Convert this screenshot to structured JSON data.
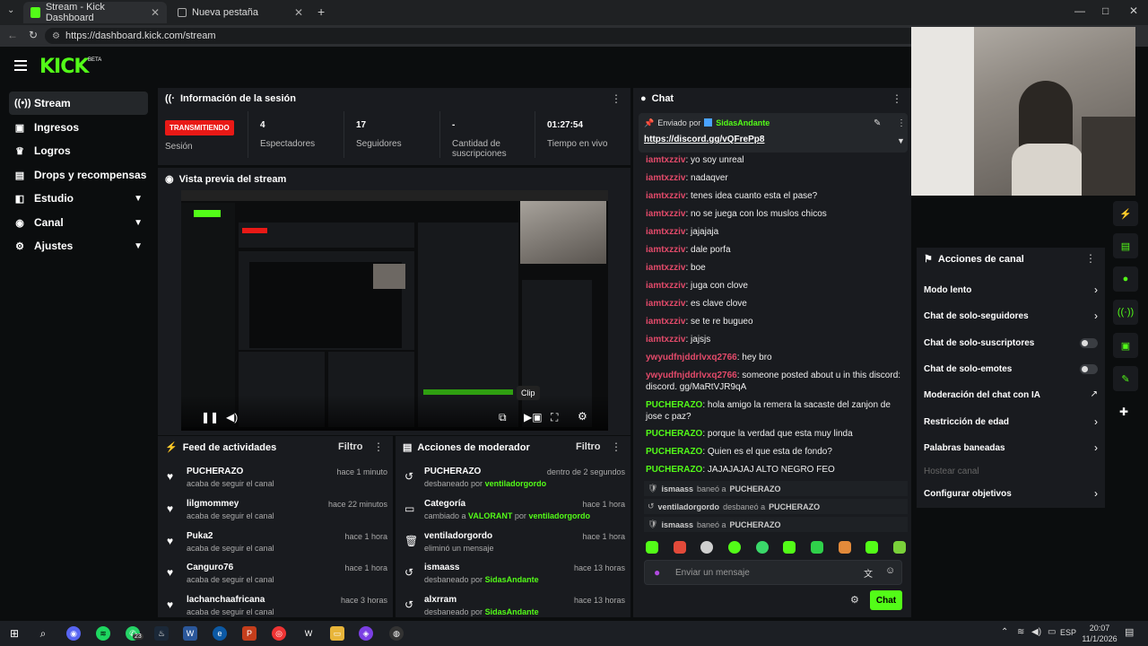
{
  "browser": {
    "tabs": [
      {
        "label": "Stream - Kick Dashboard",
        "active": true
      },
      {
        "label": "Nueva pestaña",
        "active": false
      }
    ],
    "url": "https://dashboard.kick.com/stream"
  },
  "brand": {
    "logo": "KICK",
    "beta": "BETA",
    "accent": "#53fc18"
  },
  "sidebar": {
    "items": [
      {
        "label": "Stream",
        "icon": "broadcast-icon",
        "active": true
      },
      {
        "label": "Ingresos",
        "icon": "dollar-icon"
      },
      {
        "label": "Logros",
        "icon": "trophy-icon"
      },
      {
        "label": "Drops y recompensas",
        "icon": "gift-icon"
      },
      {
        "label": "Estudio",
        "icon": "studio-icon",
        "expandable": true
      },
      {
        "label": "Canal",
        "icon": "channel-icon",
        "expandable": true
      },
      {
        "label": "Ajustes",
        "icon": "gear-icon",
        "expandable": true
      }
    ]
  },
  "session": {
    "title": "Información de la sesión",
    "status": "TRANSMITIENDO",
    "status_label": "Sesión",
    "stats": [
      {
        "value": "4",
        "label": "Espectadores"
      },
      {
        "value": "17",
        "label": "Seguidores"
      },
      {
        "value": "-",
        "label": "Cantidad de suscripciones"
      },
      {
        "value": "01:27:54",
        "label": "Tiempo en vivo"
      }
    ]
  },
  "preview": {
    "title": "Vista previa del stream",
    "tooltip": "Clip"
  },
  "activity": {
    "title": "Feed de actividades",
    "filter": "Filtro",
    "items": [
      {
        "name": "PUCHERAZO",
        "desc": "acaba de seguir el canal",
        "time": "hace 1 minuto"
      },
      {
        "name": "lilgmommey",
        "desc": "acaba de seguir el canal",
        "time": "hace 22 minutos"
      },
      {
        "name": "Puka2",
        "desc": "acaba de seguir el canal",
        "time": "hace 1 hora"
      },
      {
        "name": "Canguro76",
        "desc": "acaba de seguir el canal",
        "time": "hace 1 hora"
      },
      {
        "name": "lachanchaafricana",
        "desc": "acaba de seguir el canal",
        "time": "hace 3 horas"
      }
    ]
  },
  "mod": {
    "title": "Acciones de moderador",
    "filter": "Filtro",
    "items": [
      {
        "name": "PUCHERAZO",
        "pre": "desbaneado por",
        "by": "ventiladorgordo",
        "post": "",
        "time": "dentro de 2 segundos",
        "icon": "unban-icon"
      },
      {
        "name": "Categoría",
        "pre": "cambiado a",
        "by": "VALORANT",
        "post": "por",
        "by2": "ventiladorgordo",
        "time": "hace 1 hora",
        "icon": "category-icon"
      },
      {
        "name": "ventiladorgordo",
        "pre": "eliminó un mensaje",
        "by": "",
        "post": "",
        "time": "hace 1 hora",
        "icon": "trash-icon"
      },
      {
        "name": "ismaass",
        "pre": "desbaneado por",
        "by": "SidasAndante",
        "post": "",
        "time": "hace 13 horas",
        "icon": "unban-icon"
      },
      {
        "name": "alxrram",
        "pre": "desbaneado por",
        "by": "SidasAndante",
        "post": "",
        "time": "hace 13 horas",
        "icon": "unban-icon"
      }
    ]
  },
  "chat": {
    "title": "Chat",
    "pinned_by_label": "Enviado por",
    "pinned_user": "SidasAndante",
    "pinned_link": "https://discord.gg/vQFrePp8",
    "messages": [
      {
        "user": "iamtxzziv",
        "text": "yo soy unreal",
        "color": "pink"
      },
      {
        "user": "iamtxzziv",
        "text": "nadaqver",
        "color": "pink"
      },
      {
        "user": "iamtxzziv",
        "text": "tenes idea cuanto esta el pase?",
        "color": "pink"
      },
      {
        "user": "iamtxzziv",
        "text": "no se juega con los muslos chicos",
        "color": "pink"
      },
      {
        "user": "iamtxzziv",
        "text": "jajajaja",
        "color": "pink"
      },
      {
        "user": "iamtxzziv",
        "text": "dale porfa",
        "color": "pink"
      },
      {
        "user": "iamtxzziv",
        "text": "boe",
        "color": "pink"
      },
      {
        "user": "iamtxzziv",
        "text": "juga con clove",
        "color": "pink"
      },
      {
        "user": "iamtxzziv",
        "text": "es clave clove",
        "color": "pink"
      },
      {
        "user": "iamtxzziv",
        "text": "se te re bugueo",
        "color": "pink"
      },
      {
        "user": "iamtxzziv",
        "text": "jajsjs",
        "color": "pink"
      },
      {
        "user": "ywyudfnjddrlvxq2766",
        "text": "hey bro",
        "color": "pink"
      },
      {
        "user": "ywyudfnjddrlvxq2766",
        "text": "someone posted about u in this discord: discord. gg/MaRtVJR9qA",
        "color": "pink"
      },
      {
        "user": "PUCHERAZO",
        "text": "hola amigo la remera la sacaste del zanjon de jose c paz?",
        "color": "green"
      },
      {
        "user": "PUCHERAZO",
        "text": "porque la verdad que esta muy linda",
        "color": "green"
      },
      {
        "user": "PUCHERAZO",
        "text": "Quien es el que esta de fondo?",
        "color": "green"
      },
      {
        "user": "PUCHERAZO",
        "text": "JAJAJAJAJ ALTO NEGRO FEO",
        "color": "green"
      }
    ],
    "system": [
      {
        "actor": "ismaass",
        "action": "baneó a",
        "target": "PUCHERAZO"
      },
      {
        "actor": "ventiladorgordo",
        "action": "desbaneó a",
        "target": "PUCHERAZO"
      },
      {
        "actor": "ismaass",
        "action": "baneó a",
        "target": "PUCHERAZO"
      }
    ],
    "placeholder": "Enviar un mensaje",
    "send_label": "Chat"
  },
  "actions": {
    "title": "Acciones de canal",
    "items": [
      {
        "label": "Modo lento",
        "kind": "chevron"
      },
      {
        "label": "Chat de solo-seguidores",
        "kind": "chevron"
      },
      {
        "label": "Chat de solo-suscriptores",
        "kind": "toggle"
      },
      {
        "label": "Chat de solo-emotes",
        "kind": "toggle"
      },
      {
        "label": "Moderación del chat con IA",
        "kind": "external"
      },
      {
        "label": "Restricción de edad",
        "kind": "chevron"
      },
      {
        "label": "Palabras baneadas",
        "kind": "chevron"
      },
      {
        "label": "Hostear canal",
        "kind": "disabled"
      },
      {
        "label": "Configurar objetivos",
        "kind": "chevron"
      }
    ]
  },
  "taskbar": {
    "lang": "ESP",
    "time": "20:07",
    "date": "11/1/2026",
    "whatsapp_badge": "23"
  }
}
